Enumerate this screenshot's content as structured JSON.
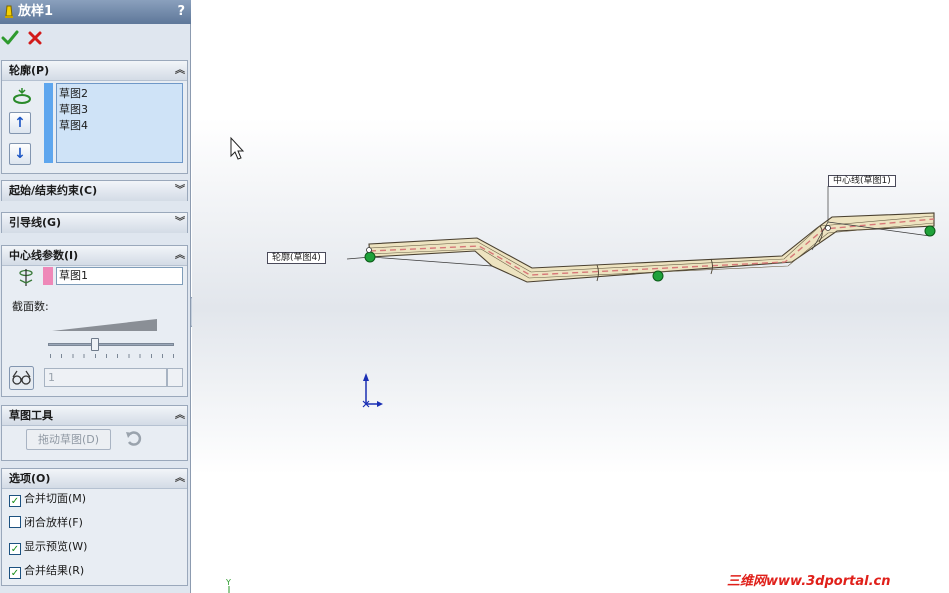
{
  "property_manager": {
    "title": "放样1",
    "help": "?",
    "ok_icon": "check-icon",
    "cancel_icon": "x-icon",
    "profile": {
      "header": "轮廓(P)",
      "items": [
        {
          "label": "草图2"
        },
        {
          "label": "草图3"
        },
        {
          "label": "草图4"
        }
      ]
    },
    "start_end": {
      "header": "起始/结束约束(C)"
    },
    "guides": {
      "header": "引导线(G)"
    },
    "centerline": {
      "header": "中心线参数(I)",
      "sketch": "草图1",
      "sections_label": "截面数:",
      "sections_value": "1"
    },
    "sketch_tools": {
      "header": "草图工具",
      "drag_sketch": "拖动草图(D)"
    },
    "options": {
      "header": "选项(O)",
      "items": [
        {
          "label": "合并切面(M)",
          "checked": true
        },
        {
          "label": "闭合放样(F)",
          "checked": false
        },
        {
          "label": "显示预览(W)",
          "checked": true
        },
        {
          "label": "合并结果(R)",
          "checked": true
        }
      ]
    }
  },
  "viewport": {
    "callout_profile": "轮廓(草图4)",
    "callout_centerline": "中心线(草图1)",
    "watermark": "三维网www.3dportal.cn",
    "triad_y": "Y"
  },
  "colors": {
    "tube": "#ede3c0",
    "tube_edge": "#4a4030",
    "handle": "#1fa13a",
    "accent": "#5ea6ee",
    "centerline_swatch": "#ee88b8"
  }
}
